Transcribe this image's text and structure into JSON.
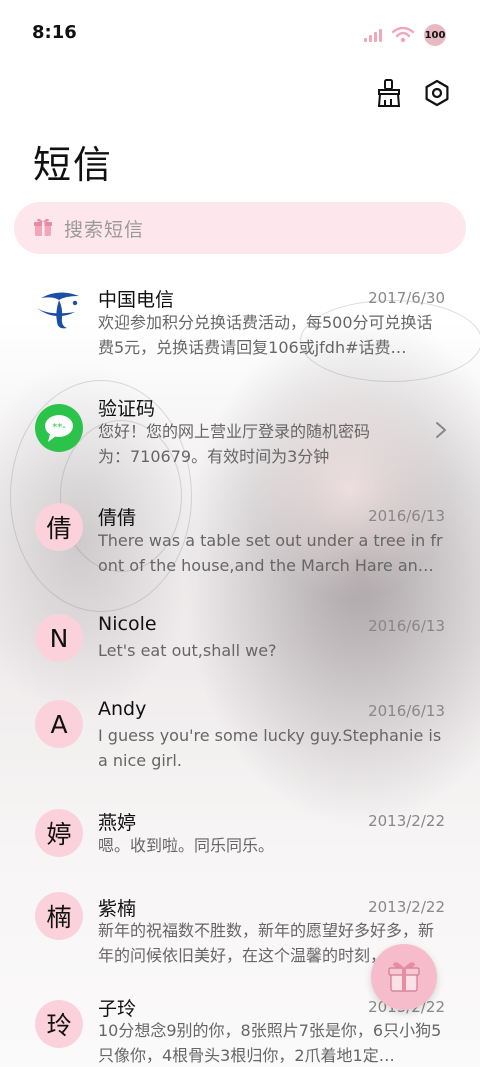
{
  "status_bar": {
    "time": "8:16",
    "battery": "100",
    "icons": [
      "signal-icon",
      "wifi-icon",
      "battery-icon"
    ]
  },
  "header": {
    "title": "短信",
    "actions": [
      {
        "name": "clean-icon",
        "label": ""
      },
      {
        "name": "settings-icon",
        "label": ""
      }
    ]
  },
  "search": {
    "placeholder": "搜索短信",
    "icon": "gift-box-icon"
  },
  "colors": {
    "accent_pink": "#fbd2db",
    "search_bg": "#fde6ec",
    "fab_bg": "#f6bccb",
    "telecom_blue": "#1a4fa3",
    "message_green": "#2bc34a"
  },
  "conversations": [
    {
      "avatar_type": "logo",
      "avatar_icon": "china-telecom-logo-icon",
      "name": "中国电信",
      "date": "2017/6/30",
      "preview": "欢迎参加积分兑换话费活动，每500分可兑换话费5元，兑换话费请回复106或jfdh#话费…"
    },
    {
      "avatar_type": "logo",
      "avatar_icon": "message-bubble-icon",
      "name": "验证码",
      "date": "",
      "preview": "您好！您的网上营业厅登录的随机密码为：710679。有效时间为3分钟",
      "has_chevron": true
    },
    {
      "avatar_type": "letter",
      "avatar_text": "倩",
      "name": "倩倩",
      "date": "2016/6/13",
      "preview": "There was a table set out under a tree in front of the house,and the March Hare an…"
    },
    {
      "avatar_type": "letter",
      "avatar_text": "N",
      "name": "Nicole",
      "date": "2016/6/13",
      "preview": "Let's eat out,shall we?"
    },
    {
      "avatar_type": "letter",
      "avatar_text": "A",
      "name": "Andy",
      "date": "2016/6/13",
      "preview": "I guess you're some lucky guy.Stephanie is a nice girl."
    },
    {
      "avatar_type": "letter",
      "avatar_text": "婷",
      "name": "燕婷",
      "date": "2013/2/22",
      "preview": "嗯。收到啦。同乐同乐。"
    },
    {
      "avatar_type": "letter",
      "avatar_text": "楠",
      "name": "紫楠",
      "date": "2013/2/22",
      "preview": "新年的祝福数不胜数，新年的愿望好多好多，新年的问候依旧美好，在这个温馨的时刻，…"
    },
    {
      "avatar_type": "letter",
      "avatar_text": "玲",
      "name": "子玲",
      "date": "2013/2/22",
      "preview": "10分想念9别的你，8张照片7张是你，6只小狗5只像你，4根骨头3根归你，2爪着地1定…"
    }
  ],
  "fab": {
    "icon": "gift-box-icon"
  }
}
